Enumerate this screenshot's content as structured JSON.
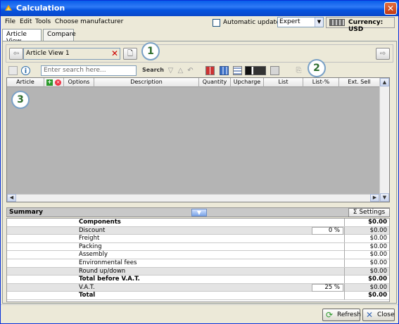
{
  "window": {
    "title": "Calculation"
  },
  "menu": [
    "File",
    "Edit",
    "Tools",
    "Choose manufacturer"
  ],
  "auto_update": {
    "label": "Automatic update",
    "checked": false
  },
  "mode_select": {
    "value": "Expert"
  },
  "currency": {
    "label": "Currency: USD"
  },
  "tabs": [
    {
      "label": "Article View",
      "active": true
    },
    {
      "label": "Compare",
      "active": false
    }
  ],
  "view": {
    "name": "Article View 1"
  },
  "callouts": [
    "1",
    "2",
    "3"
  ],
  "search": {
    "placeholder": "Enter search here...",
    "button": "Search"
  },
  "grid": {
    "columns": [
      "Article",
      "Options",
      "Description",
      "Quantity",
      "Upcharge",
      "List",
      "List-%",
      "Ext. Sell"
    ]
  },
  "summary": {
    "title": "Summary",
    "settings_label": "Settings",
    "rows": [
      {
        "label": "Components",
        "pct": "",
        "amount": "$0.00"
      },
      {
        "label": "Discount",
        "pct": "0 %",
        "amount": "$0.00"
      },
      {
        "label": "Freight",
        "pct": "",
        "amount": "$0.00"
      },
      {
        "label": "Packing",
        "pct": "",
        "amount": "$0.00"
      },
      {
        "label": "Assembly",
        "pct": "",
        "amount": "$0.00"
      },
      {
        "label": "Environmental fees",
        "pct": "",
        "amount": "$0.00"
      },
      {
        "label": "Round up/down",
        "pct": "",
        "amount": "$0.00"
      },
      {
        "label": "Total before V.A.T.",
        "pct": "",
        "amount": "$0.00"
      },
      {
        "label": "V.A.T.",
        "pct": "25 %",
        "amount": "$0.00"
      },
      {
        "label": "Total",
        "pct": "",
        "amount": "$0.00"
      }
    ]
  },
  "buttons": {
    "refresh": "Refresh",
    "close": "Close"
  }
}
